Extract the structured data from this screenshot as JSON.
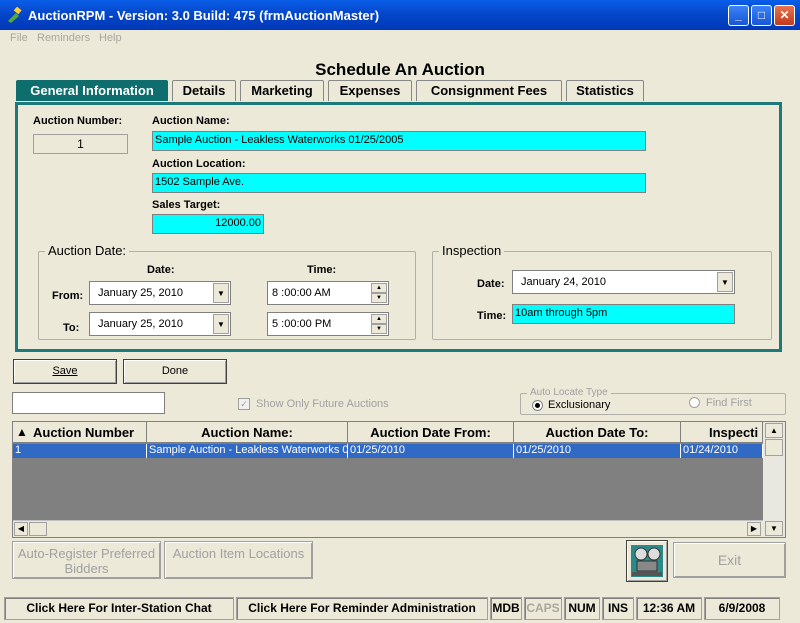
{
  "window": {
    "title": "AuctionRPM - Version: 3.0 Build: 475    (frmAuctionMaster)"
  },
  "menu": [
    "File",
    "Reminders",
    "Help"
  ],
  "heading": "Schedule An Auction",
  "tabs": [
    "General Information",
    "Details",
    "Marketing",
    "Expenses",
    "Consignment Fees",
    "Statistics"
  ],
  "general": {
    "auction_number_label": "Auction Number:",
    "auction_number": "1",
    "auction_name_label": "Auction Name:",
    "auction_name": "Sample Auction - Leakless Waterworks 01/25/2005",
    "auction_location_label": "Auction Location:",
    "auction_location": "1502 Sample Ave.",
    "sales_target_label": "Sales Target:",
    "sales_target": "12000.00"
  },
  "auction_date": {
    "title": "Auction Date:",
    "date_header": "Date:",
    "time_header": "Time:",
    "from_label": "From:",
    "to_label": "To:",
    "from_date": "January   25, 2010",
    "to_date": "January   25, 2010",
    "from_time": "8 :00:00 AM",
    "to_time": "5 :00:00 PM"
  },
  "inspection": {
    "title": "Inspection",
    "date_label": "Date:",
    "date": "January   24, 2010",
    "time_label": "Time:",
    "time": "10am through 5pm"
  },
  "buttons": {
    "save": "Save",
    "done": "Done",
    "auto_register": "Auto-Register Preferred Bidders",
    "item_locations": "Auction Item Locations",
    "exit": "Exit"
  },
  "filter": {
    "search_value": "",
    "show_future": "Show Only Future Auctions",
    "locate_title": "Auto Locate Type",
    "exclusionary": "Exclusionary",
    "find_first": "Find First"
  },
  "grid": {
    "columns": [
      "Auction Number",
      "Auction Name:",
      "Auction Date From:",
      "Auction Date To:",
      "Inspecti"
    ],
    "rows": [
      [
        "1",
        "Sample Auction - Leakless Waterworks 0",
        "01/25/2010",
        "01/25/2010",
        "01/24/2010"
      ]
    ]
  },
  "statusbar": {
    "chat": "Click Here For Inter-Station Chat",
    "reminder": "Click Here For Reminder Administration",
    "mdb": "MDB",
    "caps": "CAPS",
    "num": "NUM",
    "ins": "INS",
    "time": "12:36 AM",
    "date": "6/9/2008"
  },
  "colors": {
    "accent": "#1e7a7a",
    "field": "#00ffff",
    "selection": "#316ac5"
  }
}
